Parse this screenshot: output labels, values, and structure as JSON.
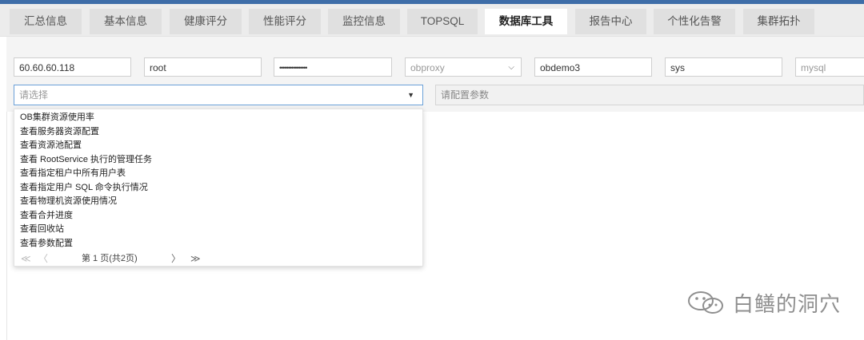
{
  "tabs": [
    {
      "label": "汇总信息",
      "active": false
    },
    {
      "label": "基本信息",
      "active": false
    },
    {
      "label": "健康评分",
      "active": false
    },
    {
      "label": "性能评分",
      "active": false
    },
    {
      "label": "监控信息",
      "active": false
    },
    {
      "label": "TOPSQL",
      "active": false
    },
    {
      "label": "数据库工具",
      "active": true
    },
    {
      "label": "报告中心",
      "active": false
    },
    {
      "label": "个性化告警",
      "active": false
    },
    {
      "label": "集群拓扑",
      "active": false
    }
  ],
  "connection": {
    "host": "60.60.60.118",
    "user": "root",
    "password_mask": "••••••••••••••••",
    "proxy": "obproxy",
    "tenant": "obdemo3",
    "tenant_user": "sys",
    "db_type": "mysql"
  },
  "tool_select": {
    "placeholder": "请选择"
  },
  "param_input": {
    "placeholder": "请配置参数"
  },
  "dropdown": {
    "options": [
      "OB集群资源使用率",
      "查看服务器资源配置",
      "查看资源池配置",
      "查看 RootService 执行的管理任务",
      "查看指定租户中所有用户表",
      "查看指定用户 SQL 命令执行情况",
      "查看物理机资源使用情况",
      "查看合并进度",
      "查看回收站",
      "查看参数配置"
    ],
    "pager": {
      "first": "≪",
      "prev": "〈",
      "text": "第 1 页(共2页)",
      "next": "〉",
      "last": "≫"
    }
  },
  "watermark": {
    "text": "白鳝的洞穴",
    "icon": "wechat-icon"
  },
  "colors": {
    "topbar": "#3e6da8",
    "focus_border": "#6aa0d8"
  }
}
